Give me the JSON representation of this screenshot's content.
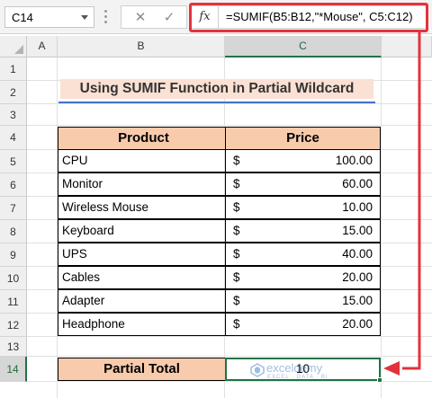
{
  "formula_bar": {
    "name_box": "C14",
    "cancel_symbol": "✕",
    "enter_symbol": "✓",
    "fx_label": "fx",
    "formula": "=SUMIF(B5:B12,\"*Mouse\", C5:C12)"
  },
  "columns": [
    "A",
    "B",
    "C"
  ],
  "rows": [
    "1",
    "2",
    "3",
    "4",
    "5",
    "6",
    "7",
    "8",
    "9",
    "10",
    "11",
    "12",
    "13",
    "14"
  ],
  "title": "Using SUMIF Function in Partial Wildcard",
  "table": {
    "headers": {
      "product": "Product",
      "price": "Price"
    },
    "currency": "$",
    "items": [
      {
        "product": "CPU",
        "price": "100.00"
      },
      {
        "product": "Monitor",
        "price": "60.00"
      },
      {
        "product": "Wireless Mouse",
        "price": "10.00"
      },
      {
        "product": "Keyboard",
        "price": "15.00"
      },
      {
        "product": "UPS",
        "price": "40.00"
      },
      {
        "product": "Cables",
        "price": "20.00"
      },
      {
        "product": "Adapter",
        "price": "15.00"
      },
      {
        "product": "Headphone",
        "price": "20.00"
      }
    ]
  },
  "total": {
    "label": "Partial Total",
    "value": "10"
  },
  "watermark": {
    "name": "exceldemy",
    "tagline": "EXCEL · DATA · BI"
  },
  "colors": {
    "accent": "#e2333b",
    "selection": "#217346",
    "header_fill": "#f8cbad",
    "title_fill": "#fbe1d3",
    "title_underline": "#4472c4"
  }
}
